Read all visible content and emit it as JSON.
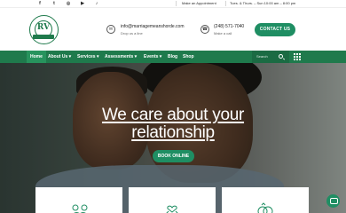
{
  "topbar": {
    "social_icons": [
      "facebook-icon",
      "twitter-icon",
      "instagram-icon",
      "youtube-icon",
      "tiktok-icon"
    ],
    "social_glyphs": [
      "f",
      "t",
      "◎",
      "▶",
      "♪"
    ],
    "hours_line1": "Make an Appointment",
    "hours_line2": "Tues. & Thurs. – Sun 10:00 am – 8:00 pm"
  },
  "header": {
    "logo_text": "RV",
    "email": "info@marriagemeanshorde.com",
    "email_sub": "Drop us a line",
    "phone": "(248) 571-7040",
    "phone_sub": "Make a call",
    "contact_button": "CONTACT US"
  },
  "nav": {
    "items": [
      "Home",
      "About Us ▾",
      "Services ▾",
      "Assessments ▾",
      "Events ▾",
      "Blog",
      "Shop"
    ],
    "search_placeholder": "Search"
  },
  "hero": {
    "title_line1": "We care about your",
    "title_line2": "relationship",
    "button": "BOOK ONLINE"
  },
  "colors": {
    "brand_green": "#1f7a4c",
    "accent_green": "#1f8e63"
  }
}
